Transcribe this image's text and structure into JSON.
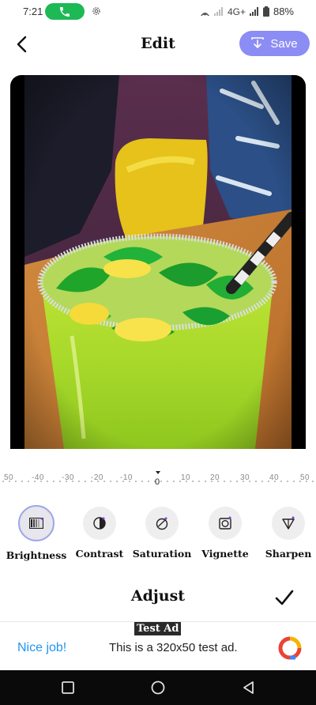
{
  "status": {
    "time": "7:21",
    "network": "4G+",
    "battery": "88%"
  },
  "header": {
    "title": "Edit",
    "save_label": "Save"
  },
  "ruler": {
    "labels": [
      "50",
      "-40",
      "-30",
      "-20",
      "-10",
      "0",
      "10",
      "20",
      "30",
      "40",
      "50"
    ],
    "current": "0"
  },
  "tools": [
    {
      "label": "Brightness",
      "icon": "brightness-icon",
      "selected": true
    },
    {
      "label": "Contrast",
      "icon": "contrast-icon",
      "selected": false
    },
    {
      "label": "Saturation",
      "icon": "saturation-icon",
      "selected": false
    },
    {
      "label": "Vignette",
      "icon": "vignette-icon",
      "selected": false
    },
    {
      "label": "Sharpen",
      "icon": "sharpen-icon",
      "selected": false
    }
  ],
  "adjust": {
    "title": "Adjust"
  },
  "ad": {
    "badge": "Test Ad",
    "headline": "Nice job!",
    "body": "This is a 320x50 test ad."
  },
  "colors": {
    "accent": "#8c8cf5",
    "ad_link": "#2196f3",
    "call_green": "#1db954"
  }
}
